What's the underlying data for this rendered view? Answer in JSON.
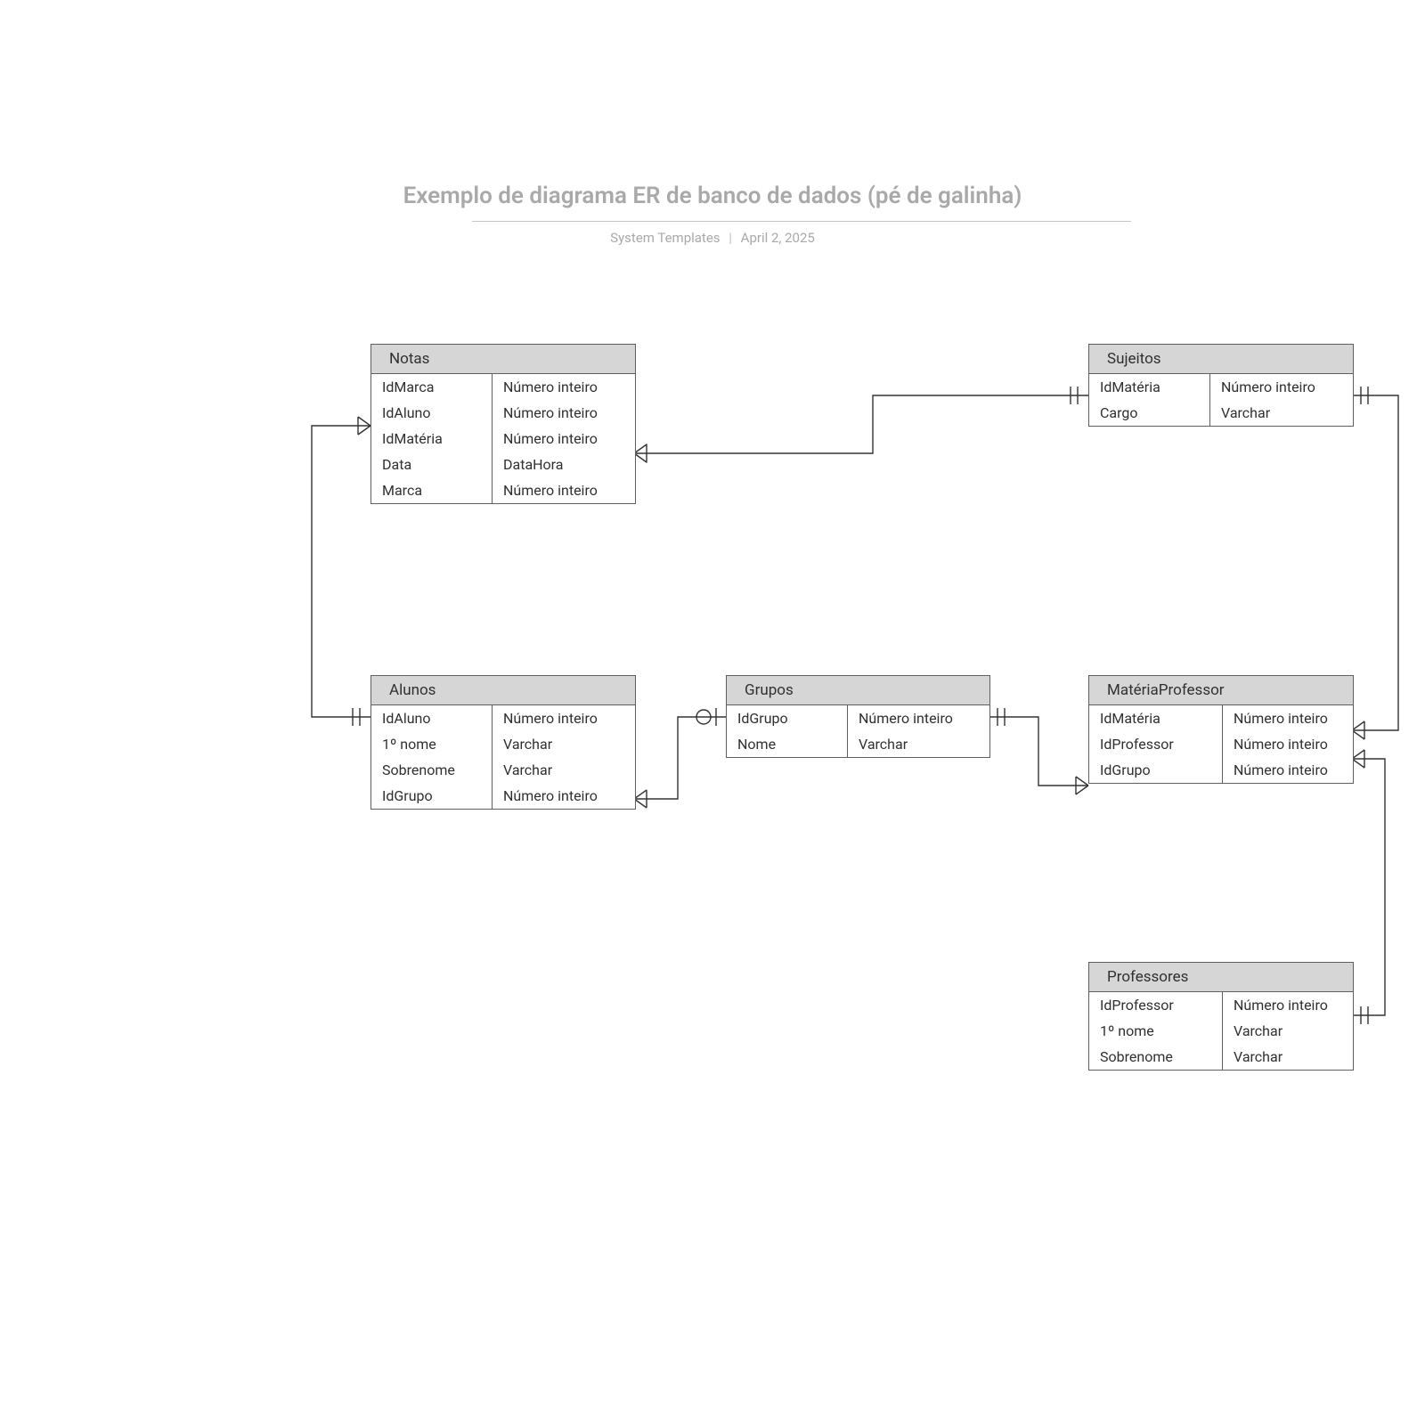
{
  "title": "Exemplo de diagrama ER de banco de dados (pé de galinha)",
  "subtitle_author": "System Templates",
  "subtitle_date": "April 2, 2025",
  "entities": {
    "notas": {
      "name": "Notas",
      "rows": [
        {
          "field": "IdMarca",
          "type": "Número inteiro"
        },
        {
          "field": "IdAluno",
          "type": "Número inteiro"
        },
        {
          "field": "IdMatéria",
          "type": "Número inteiro"
        },
        {
          "field": "Data",
          "type": "DataHora"
        },
        {
          "field": "Marca",
          "type": "Número inteiro"
        }
      ]
    },
    "sujeitos": {
      "name": "Sujeitos",
      "rows": [
        {
          "field": "IdMatéria",
          "type": "Número inteiro"
        },
        {
          "field": "Cargo",
          "type": "Varchar"
        }
      ]
    },
    "alunos": {
      "name": "Alunos",
      "rows": [
        {
          "field": "IdAluno",
          "type": "Número inteiro"
        },
        {
          "field": "1º nome",
          "type": "Varchar"
        },
        {
          "field": "Sobrenome",
          "type": "Varchar"
        },
        {
          "field": "IdGrupo",
          "type": "Número inteiro"
        }
      ]
    },
    "grupos": {
      "name": "Grupos",
      "rows": [
        {
          "field": "IdGrupo",
          "type": "Número inteiro"
        },
        {
          "field": "Nome",
          "type": "Varchar"
        }
      ]
    },
    "materiaprof": {
      "name": "MatériaProfessor",
      "rows": [
        {
          "field": "IdMatéria",
          "type": "Número inteiro"
        },
        {
          "field": "IdProfessor",
          "type": "Número inteiro"
        },
        {
          "field": "IdGrupo",
          "type": "Número inteiro"
        }
      ]
    },
    "professores": {
      "name": "Professores",
      "rows": [
        {
          "field": "IdProfessor",
          "type": "Número inteiro"
        },
        {
          "field": "1º nome",
          "type": "Varchar"
        },
        {
          "field": "Sobrenome",
          "type": "Varchar"
        }
      ]
    }
  }
}
